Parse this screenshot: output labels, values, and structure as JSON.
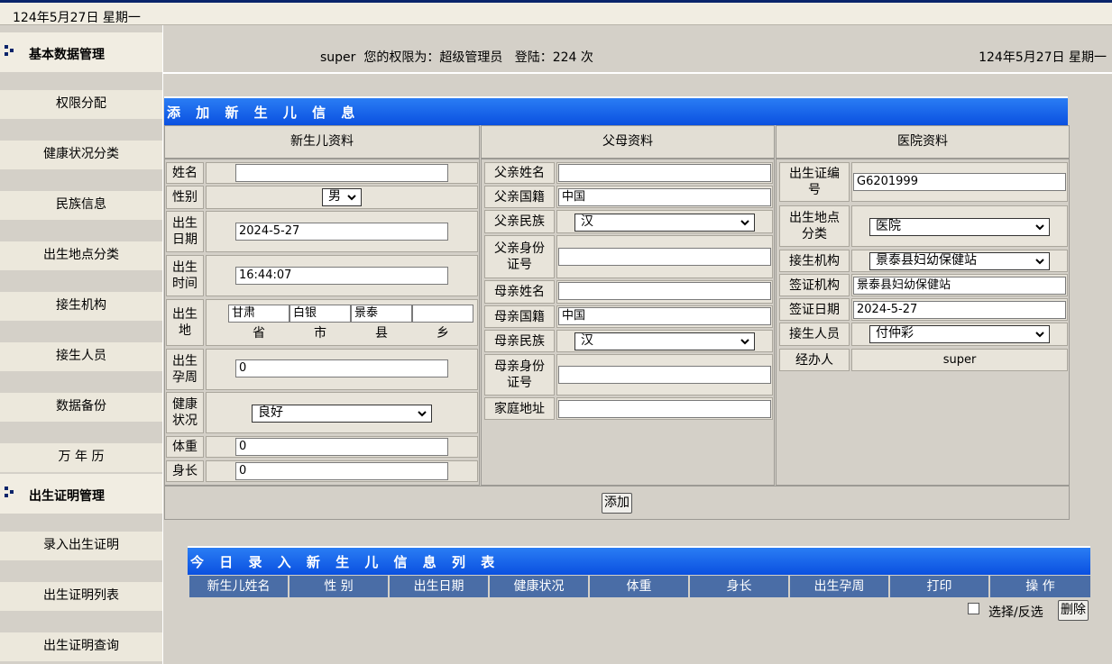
{
  "topbar": {
    "date": "124年5月27日 星期一"
  },
  "sidebar": {
    "section1": "基本数据管理",
    "items1": [
      "权限分配",
      "健康状况分类",
      "民族信息",
      "出生地点分类",
      "接生机构",
      "接生人员",
      "数据备份",
      "万 年 历"
    ],
    "section2": "出生证明管理",
    "items2": [
      "录入出生证明",
      "出生证明列表",
      "出生证明查询"
    ]
  },
  "info": {
    "user": "super",
    "perm_text": "您的权限为：超级管理员",
    "login_text": "登陆：224 次",
    "date": "124年5月27日 星期一"
  },
  "form": {
    "title": "添 加 新 生 儿 信 息",
    "col_baby": "新生儿资料",
    "col_parent": "父母资料",
    "col_hospital": "医院资料",
    "baby": {
      "name_label": "姓名",
      "name_value": "",
      "sex_label": "性别",
      "sex_value": "男",
      "dob_label": "出生日期",
      "dob_value": "2024-5-27",
      "tob_label": "出生时间",
      "tob_value": "16:44:07",
      "pob_label": "出生地",
      "pob_province": "甘肃",
      "pob_city": "白银",
      "pob_county": "景泰",
      "pob_town": "",
      "pob_sub_province": "省",
      "pob_sub_city": "市",
      "pob_sub_county": "县",
      "pob_sub_town": "乡",
      "weeks_label": "出生孕周",
      "weeks_value": "0",
      "health_label": "健康状况",
      "health_value": "良好",
      "weight_label": "体重",
      "weight_value": "0",
      "height_label": "身长",
      "height_value": "0"
    },
    "parent": {
      "father_name_label": "父亲姓名",
      "father_name_value": "",
      "father_nation_label": "父亲国籍",
      "father_nation_value": "中国",
      "father_ethnic_label": "父亲民族",
      "father_ethnic_value": "汉",
      "father_id_label": "父亲身份证号",
      "father_id_value": "",
      "mother_name_label": "母亲姓名",
      "mother_name_value": "",
      "mother_nation_label": "母亲国籍",
      "mother_nation_value": "中国",
      "mother_ethnic_label": "母亲民族",
      "mother_ethnic_value": "汉",
      "mother_id_label": "母亲身份证号",
      "mother_id_value": "",
      "address_label": "家庭地址",
      "address_value": ""
    },
    "hospital": {
      "cert_no_label": "出生证编号",
      "cert_no_value": "G6201999",
      "place_label": "出生地点分类",
      "place_value": "医院",
      "org_label": "接生机构",
      "org_value": "景泰县妇幼保健站",
      "issue_org_label": "签证机构",
      "issue_org_value": "景泰县妇幼保健站",
      "issue_date_label": "签证日期",
      "issue_date_value": "2024-5-27",
      "midwife_label": "接生人员",
      "midwife_value": "付仲彩",
      "handler_label": "经办人",
      "handler_value": "super"
    },
    "add_button": "添加"
  },
  "list": {
    "title": "今 日 录 入 新 生 儿 信 息 列 表",
    "columns": [
      "新生儿姓名",
      "性 别",
      "出生日期",
      "健康状况",
      "体重",
      "身长",
      "出生孕周",
      "打印",
      "操 作"
    ],
    "select_label": "选择/反选",
    "delete_button": "删除"
  }
}
